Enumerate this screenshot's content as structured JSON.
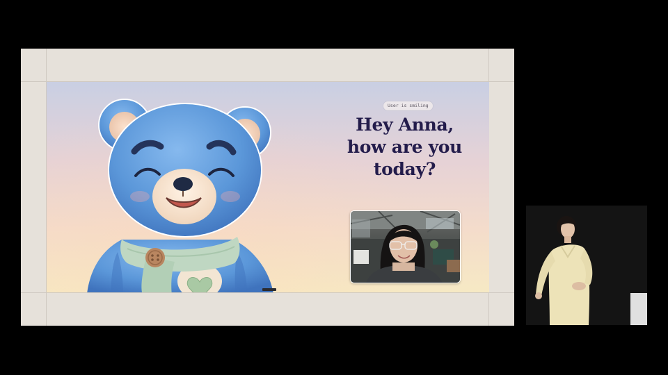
{
  "slide": {
    "status_badge": "User is smiling",
    "greeting_lines": [
      "Hey Anna,",
      "how are you",
      "today?"
    ]
  },
  "colors": {
    "greeting_text": "#231c4b",
    "bear_fur": "#5b97d9",
    "scarf": "#bfd7c2",
    "button": "#b98660",
    "background_top": "#c9cfe3",
    "background_bottom": "#f6e9c4"
  },
  "icons": {
    "character": "blue-teddy-bear",
    "heart_patch": "heart-icon"
  }
}
